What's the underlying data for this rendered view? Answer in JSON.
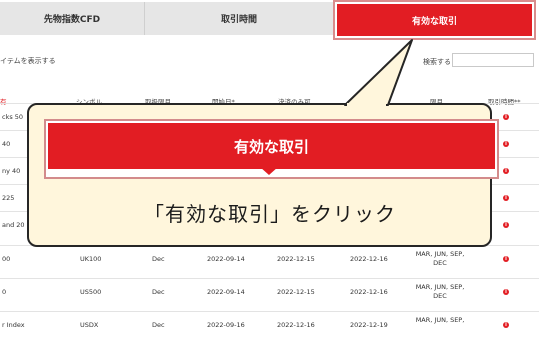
{
  "tabs": [
    {
      "label": "先物指数CFD"
    },
    {
      "label": "取引時間"
    },
    {
      "label": "有効な取引"
    }
  ],
  "toolbar": {
    "show_items": "イテムを表示する",
    "search_label": "検索する",
    "search_value": ""
  },
  "table": {
    "headers": [
      "有",
      "シンボル",
      "取扱限月",
      "開始日*",
      "決済のみ可",
      "",
      "限月",
      "取引時間**"
    ],
    "rows": [
      {
        "name": "cks 50",
        "symbol": "",
        "month": "",
        "start": "",
        "close_only": "",
        "expiry": "",
        "months": ""
      },
      {
        "name": "40",
        "symbol": "",
        "month": "",
        "start": "",
        "close_only": "",
        "expiry": "",
        "months": ""
      },
      {
        "name": "ny 40",
        "symbol": "",
        "month": "",
        "start": "",
        "close_only": "",
        "expiry": "",
        "months": ""
      },
      {
        "name": "225",
        "symbol": "",
        "month": "",
        "start": "",
        "close_only": "",
        "expiry": "",
        "months": ""
      },
      {
        "name": "and 20",
        "symbol": "",
        "month": "",
        "start": "",
        "close_only": "",
        "expiry": "",
        "months": ""
      },
      {
        "name": "00",
        "symbol": "UK100",
        "month": "Dec",
        "start": "2022-09-14",
        "close_only": "2022-12-15",
        "expiry": "2022-12-16",
        "months": "MAR, JUN, SEP, DEC"
      },
      {
        "name": "0",
        "symbol": "US500",
        "month": "Dec",
        "start": "2022-09-14",
        "close_only": "2022-12-15",
        "expiry": "2022-12-16",
        "months": "MAR, JUN, SEP, DEC"
      },
      {
        "name": "r Index",
        "symbol": "USDX",
        "month": "Dec",
        "start": "2022-09-16",
        "close_only": "2022-12-16",
        "expiry": "2022-12-19",
        "months": "MAR, JUN, SEP,"
      }
    ]
  },
  "callout": {
    "button_label": "有効な取引",
    "instruction": "「有効な取引」をクリック"
  },
  "colors": {
    "accent": "#e21d23",
    "callout_bg": "#fff6dc"
  }
}
